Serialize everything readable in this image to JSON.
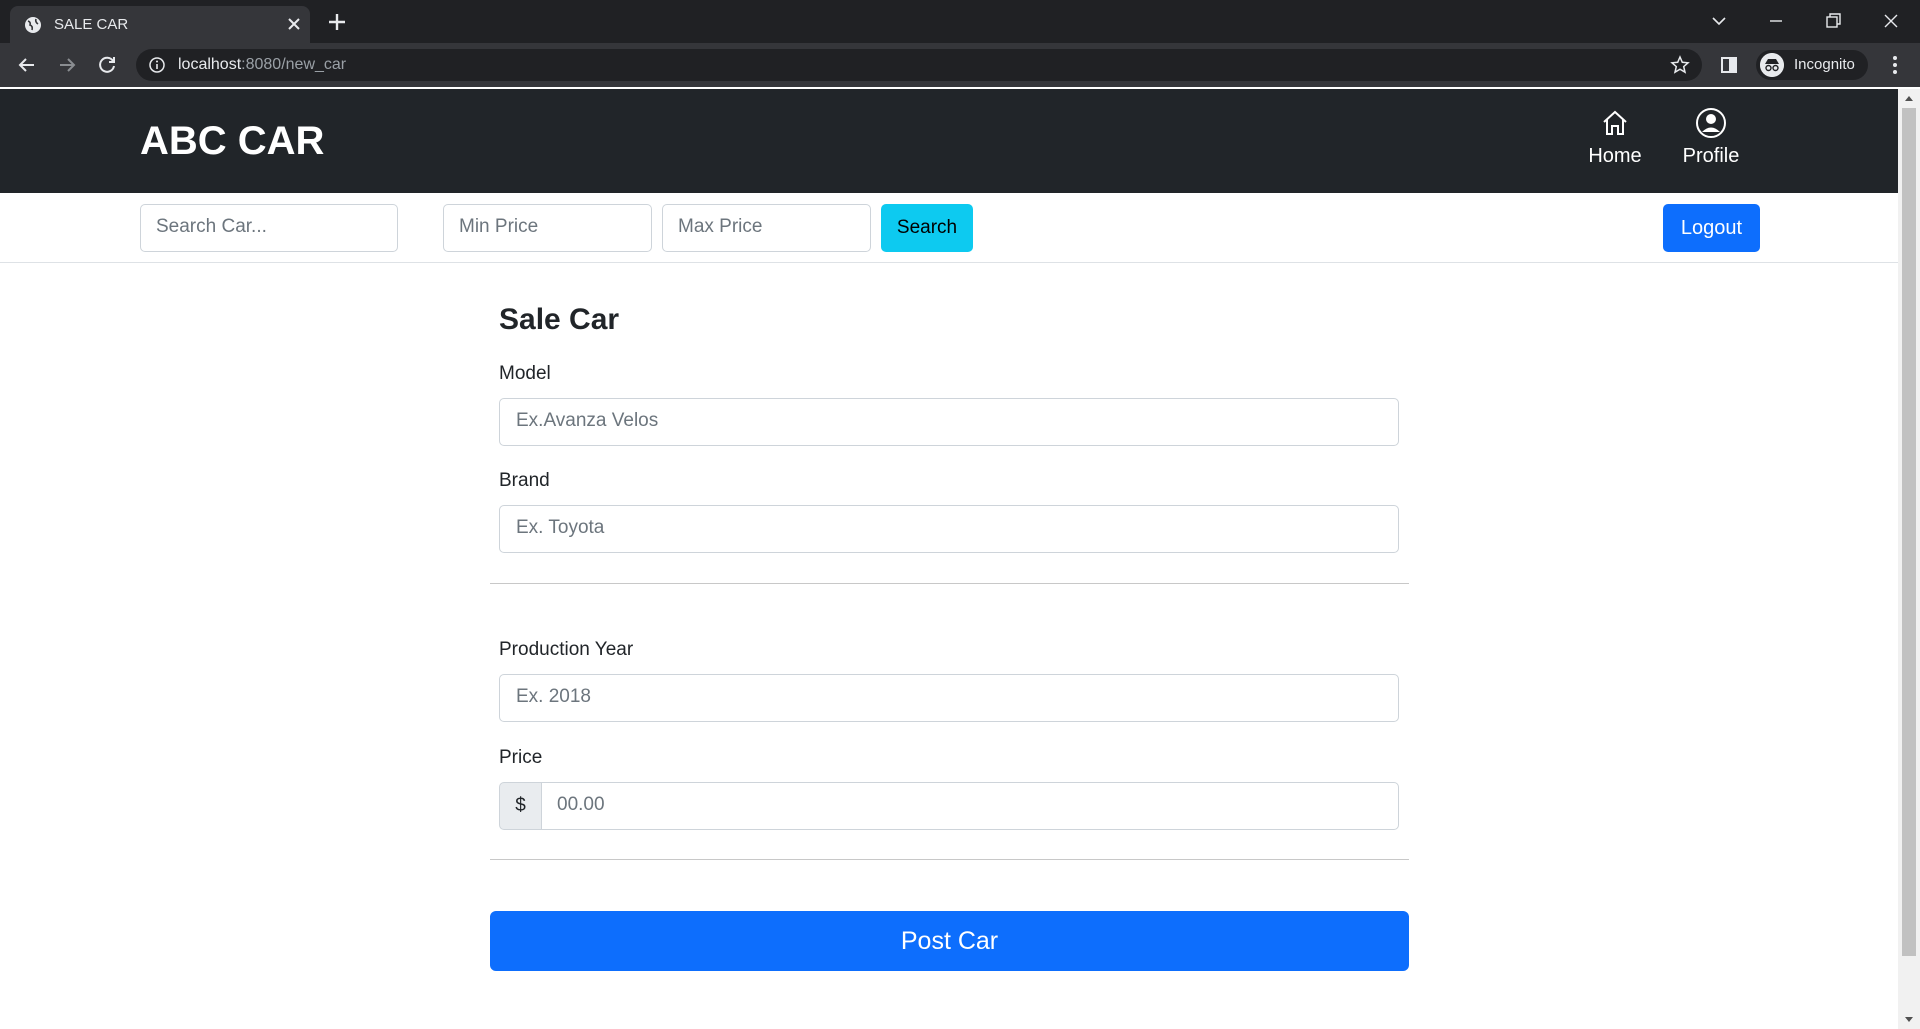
{
  "browser": {
    "tab_title": "SALE CAR",
    "url_host": "localhost",
    "url_path": ":8080/new_car",
    "profile_label": "Incognito"
  },
  "navbar": {
    "brand": "ABC CAR",
    "items": [
      {
        "label": "Home",
        "icon": "home-icon"
      },
      {
        "label": "Profile",
        "icon": "user-circle-icon"
      }
    ]
  },
  "filters": {
    "search_placeholder": "Search Car...",
    "min_price_placeholder": "Min Price",
    "max_price_placeholder": "Max Price",
    "search_button": "Search",
    "logout_button": "Logout"
  },
  "form": {
    "title": "Sale Car",
    "model_label": "Model",
    "model_placeholder": "Ex.Avanza Velos",
    "brand_label": "Brand",
    "brand_placeholder": "Ex. Toyota",
    "year_label": "Production Year",
    "year_placeholder": "Ex. 2018",
    "price_label": "Price",
    "price_addon": "$",
    "price_placeholder": "00.00",
    "submit_label": "Post Car"
  },
  "colors": {
    "navbar_bg": "#212529",
    "primary": "#0d6efd",
    "info": "#0dcaf0"
  }
}
